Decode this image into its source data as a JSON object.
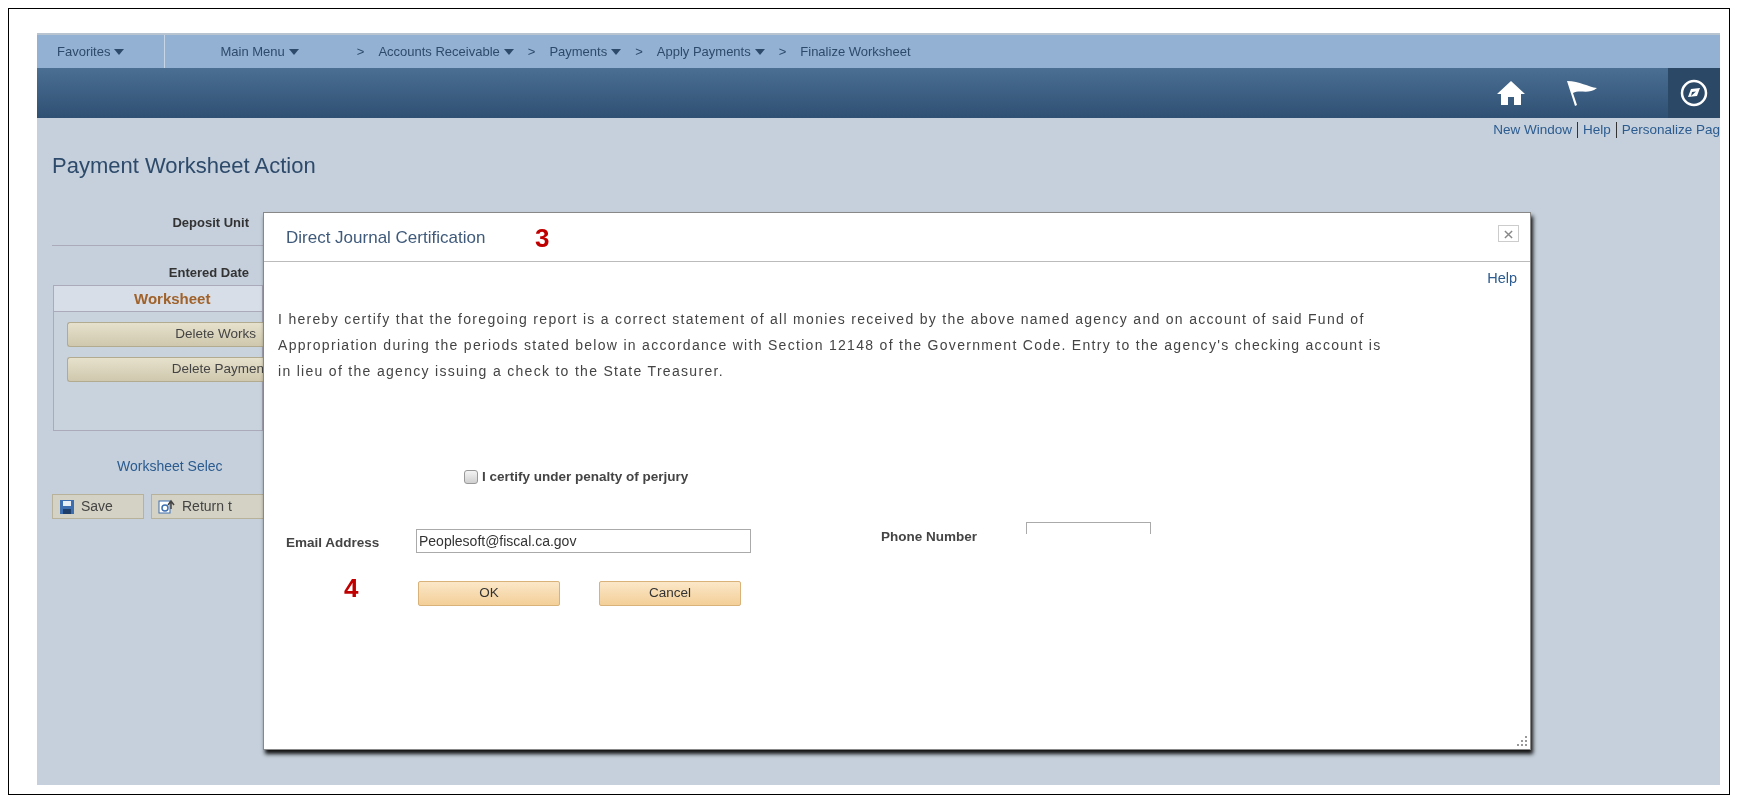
{
  "nav": {
    "items": [
      {
        "label": "Favorites",
        "dropdown": true
      },
      {
        "label": "Main Menu",
        "dropdown": true
      },
      {
        "prefix": ">",
        "label": "Accounts Receivable",
        "dropdown": true
      },
      {
        "prefix": ">",
        "label": "Payments",
        "dropdown": true
      },
      {
        "prefix": ">",
        "label": "Apply Payments",
        "dropdown": true
      },
      {
        "prefix": ">",
        "label": "Finalize Worksheet",
        "dropdown": false
      }
    ]
  },
  "header_links": [
    "New Window",
    "Help",
    "Personalize Pag"
  ],
  "page": {
    "title": "Payment Worksheet Action",
    "fields": [
      "Deposit Unit",
      "Entered Date"
    ],
    "panel_title": "Worksheet",
    "panel_buttons": [
      "Delete Works",
      "Delete Paymen"
    ],
    "link": "Worksheet Selec",
    "toolbar": [
      {
        "kind": "save",
        "label": "Save"
      },
      {
        "kind": "return",
        "label": "Return t"
      }
    ]
  },
  "dialog": {
    "title": "Direct Journal Certification",
    "callout_title": "3",
    "help": "Help",
    "paragraph": "I hereby certify that the foregoing report is a correct statement of all monies received by the above named agency and on account of said Fund of Appropriation during the periods stated below in accordance with Section 12148 of the Government Code. Entry to the agency's checking account is in lieu of the agency issuing a check to the State Treasurer.",
    "checkbox": {
      "label": "I certify under penalty of perjury",
      "checked": false
    },
    "email": {
      "label": "Email Address",
      "value": "Peoplesoft@fiscal.ca.gov"
    },
    "phone": {
      "label": "Phone Number"
    },
    "callout_buttons": "4",
    "buttons": [
      "OK",
      "Cancel"
    ]
  }
}
